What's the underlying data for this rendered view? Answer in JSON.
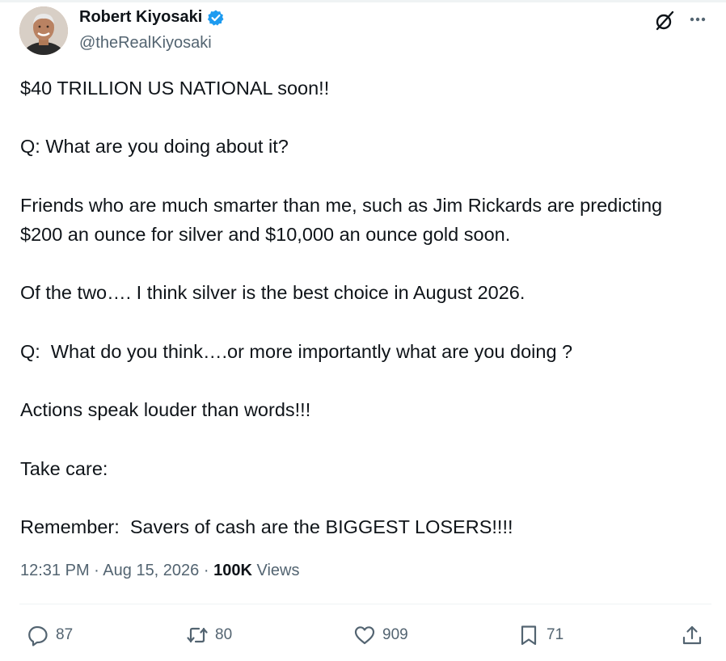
{
  "author": {
    "display_name": "Robert Kiyosaki",
    "handle": "@theRealKiyosaki",
    "verified": true
  },
  "tweet": {
    "paragraphs": [
      "$40 TRILLION US NATIONAL soon!!",
      "Q: What are you doing about it?",
      "Friends who are much smarter than me, such as Jim Rickards are predicting $200 an ounce for silver and $10,000 an ounce gold soon.",
      "Of the two…. I think silver is the best choice in August 2026.",
      "Q:  What do you think….or more importantly what are you doing ?",
      "Actions speak louder than words!!!",
      "Take care:",
      "Remember:  Savers of cash are the BIGGEST LOSERS!!!!"
    ]
  },
  "meta": {
    "time": "12:31 PM",
    "separator": "·",
    "date": "Aug 15, 2026",
    "views_count": "100K",
    "views_label": "Views"
  },
  "actions": {
    "replies": "87",
    "reposts": "80",
    "likes": "909",
    "bookmarks": "71"
  },
  "colors": {
    "text": "#0f1419",
    "secondary": "#536471",
    "verified": "#1d9bf0",
    "divider": "#eff3f4"
  },
  "icons": [
    "verified-badge-icon",
    "grok-icon",
    "more-icon",
    "reply-icon",
    "repost-icon",
    "like-icon",
    "bookmark-icon",
    "share-icon"
  ]
}
